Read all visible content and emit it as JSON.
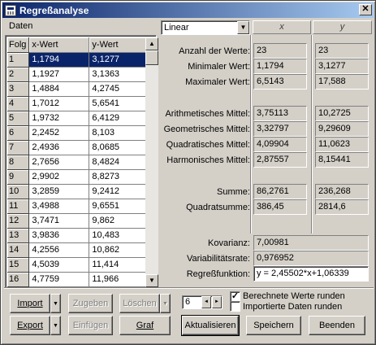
{
  "window": {
    "title": "Regreßanalyse"
  },
  "data_panel": {
    "label": "Daten",
    "headers": {
      "row": "Folg",
      "x": "x-Wert",
      "y": "y-Wert"
    },
    "rows": [
      {
        "n": "1",
        "x": "1,1794",
        "y": "3,1277"
      },
      {
        "n": "2",
        "x": "1,1927",
        "y": "3,1363"
      },
      {
        "n": "3",
        "x": "1,4884",
        "y": "4,2745"
      },
      {
        "n": "4",
        "x": "1,7012",
        "y": "5,6541"
      },
      {
        "n": "5",
        "x": "1,9732",
        "y": "6,4129"
      },
      {
        "n": "6",
        "x": "2,2452",
        "y": "8,103"
      },
      {
        "n": "7",
        "x": "2,4936",
        "y": "8,0685"
      },
      {
        "n": "8",
        "x": "2,7656",
        "y": "8,4824"
      },
      {
        "n": "9",
        "x": "2,9902",
        "y": "8,8273"
      },
      {
        "n": "10",
        "x": "3,2859",
        "y": "9,2412"
      },
      {
        "n": "11",
        "x": "3,4988",
        "y": "9,6551"
      },
      {
        "n": "12",
        "x": "3,7471",
        "y": "9,862"
      },
      {
        "n": "13",
        "x": "3,9836",
        "y": "10,483"
      },
      {
        "n": "14",
        "x": "4,2556",
        "y": "10,862"
      },
      {
        "n": "15",
        "x": "4,5039",
        "y": "11,414"
      },
      {
        "n": "16",
        "x": "4,7759",
        "y": "11,966"
      }
    ]
  },
  "model_select": {
    "value": "Linear"
  },
  "col_headers": {
    "x": "x",
    "y": "y"
  },
  "stats": {
    "count_label": "Anzahl der Werte:",
    "count_x": "23",
    "count_y": "23",
    "min_label": "Minimaler Wert:",
    "min_x": "1,1794",
    "min_y": "3,1277",
    "max_label": "Maximaler Wert:",
    "max_x": "6,5143",
    "max_y": "17,588",
    "am_label": "Arithmetisches Mittel:",
    "am_x": "3,75113",
    "am_y": "10,2725",
    "gm_label": "Geometrisches Mittel:",
    "gm_x": "3,32797",
    "gm_y": "9,29609",
    "qm_label": "Quadratisches Mittel:",
    "qm_x": "4,09904",
    "qm_y": "11,0623",
    "hm_label": "Harmonisches Mittel:",
    "hm_x": "2,87557",
    "hm_y": "8,15441",
    "sum_label": "Summe:",
    "sum_x": "86,2761",
    "sum_y": "236,268",
    "sq_label": "Quadratsumme:",
    "sq_x": "386,45",
    "sq_y": "2814,6"
  },
  "regression": {
    "cov_label": "Kovarianz:",
    "cov": "7,00981",
    "var_label": "Variabilitätsrate:",
    "var": "0,976952",
    "fn_label": "Regreßfunktion:",
    "fn": "y = 2,45502*x+1,06339"
  },
  "buttons": {
    "import": "Import",
    "zugeben": "Zugeben",
    "loeschen": "Löschen",
    "export": "Export",
    "einfuegen": "Einfügen",
    "graf": "Graf",
    "aktualisieren": "Aktualisieren",
    "speichern": "Speichern",
    "beenden": "Beenden"
  },
  "rounding": {
    "digits": "6"
  },
  "checkboxes": {
    "round": {
      "label": "Berechnete Werte runden",
      "checked": true
    },
    "import_round": {
      "label": "Importierte Daten runden",
      "checked": false
    }
  },
  "colors": {
    "title_start": "#0a246a",
    "title_end": "#a6caf0",
    "selection": "#0a246a",
    "face": "#d4d0c8"
  }
}
